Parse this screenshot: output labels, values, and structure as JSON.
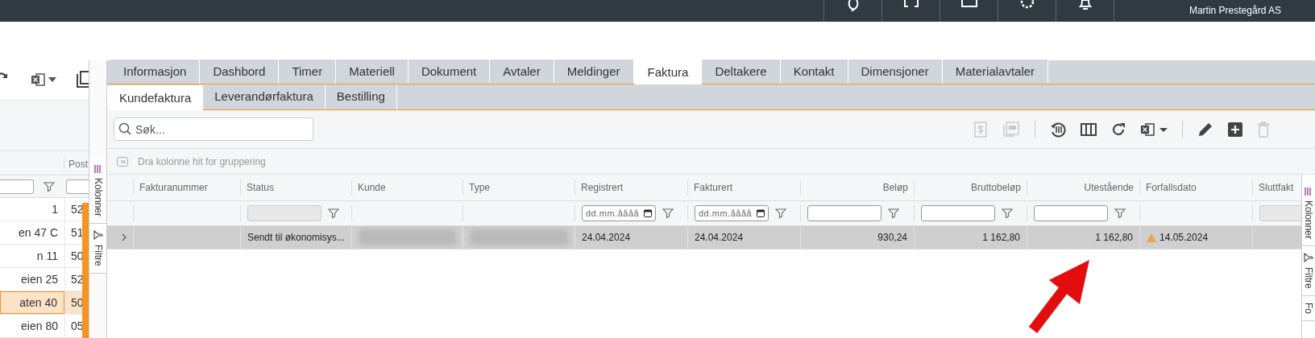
{
  "top_bar": {
    "company": "Martin Prestegård AS"
  },
  "left_panel": {
    "column_header": "Post",
    "side_tabs": [
      "Kolonner",
      "Filtre"
    ],
    "rows": [
      {
        "cells": [
          "1",
          "52"
        ],
        "selected": false
      },
      {
        "cells": [
          "en 47 C",
          "51"
        ],
        "selected": false
      },
      {
        "cells": [
          "n 11",
          "50"
        ],
        "selected": false
      },
      {
        "cells": [
          "eien 25",
          "52"
        ],
        "selected": false
      },
      {
        "cells": [
          "aten 40",
          "50"
        ],
        "selected": true
      },
      {
        "cells": [
          "eien 80",
          "05"
        ],
        "selected": false
      }
    ]
  },
  "tabs": [
    {
      "label": "Informasjon",
      "selected": false
    },
    {
      "label": "Dashbord",
      "selected": false
    },
    {
      "label": "Timer",
      "selected": false
    },
    {
      "label": "Materiell",
      "selected": false
    },
    {
      "label": "Dokument",
      "selected": false
    },
    {
      "label": "Avtaler",
      "selected": false
    },
    {
      "label": "Meldinger",
      "selected": false
    },
    {
      "label": "Faktura",
      "selected": true
    },
    {
      "label": "Deltakere",
      "selected": false
    },
    {
      "label": "Kontakt",
      "selected": false
    },
    {
      "label": "Dimensjoner",
      "selected": false
    },
    {
      "label": "Materialavtaler",
      "selected": false
    }
  ],
  "subtabs": [
    {
      "label": "Kundefaktura",
      "selected": true
    },
    {
      "label": "Leverandørfaktura",
      "selected": false
    },
    {
      "label": "Bestilling",
      "selected": false
    }
  ],
  "search": {
    "placeholder": "Søk..."
  },
  "toolbar": [
    {
      "kind": "dollar",
      "disabled": true
    },
    {
      "kind": "pdf",
      "disabled": true
    },
    {
      "kind": "sep"
    },
    {
      "kind": "history",
      "disabled": false
    },
    {
      "kind": "columns",
      "disabled": false
    },
    {
      "kind": "refresh",
      "disabled": false
    },
    {
      "kind": "excel",
      "disabled": false
    },
    {
      "kind": "sep"
    },
    {
      "kind": "edit",
      "disabled": false
    },
    {
      "kind": "add",
      "disabled": false
    },
    {
      "kind": "delete",
      "disabled": true
    }
  ],
  "group_hint": "Dra kolonne hit for gruppering",
  "grid": {
    "row": {
      "selected": true,
      "expanded": false
    },
    "columns": [
      {
        "label": "Fakturanummer",
        "kind": "plain"
      },
      {
        "label": "Status",
        "kind": "locked",
        "cell": "Sendt til økonomisys..."
      },
      {
        "label": "Kunde",
        "kind": "plain",
        "cell_redacted": true
      },
      {
        "label": "Type",
        "kind": "plain",
        "cell_redacted": true
      },
      {
        "label": "Registrert",
        "kind": "date",
        "placeholder": "dd.mm.åååå",
        "cell": "24.04.2024"
      },
      {
        "label": "Fakturert",
        "kind": "date",
        "placeholder": "dd.mm.åååå",
        "cell": "24.04.2024"
      },
      {
        "label": "Beløp",
        "kind": "amount",
        "cell": "930,24"
      },
      {
        "label": "Bruttobeløp",
        "kind": "amount",
        "cell": "1 162,80"
      },
      {
        "label": "Utestående",
        "kind": "amount",
        "cell": "1 162,80"
      },
      {
        "label": "Forfallsdato",
        "kind": "plain",
        "cell": "14.05.2024",
        "cell_warning": true
      },
      {
        "label": "Sluttfakt",
        "kind": "locked"
      }
    ]
  },
  "right_side_tabs": [
    "Kolonner",
    "Filtre",
    "Fo"
  ]
}
